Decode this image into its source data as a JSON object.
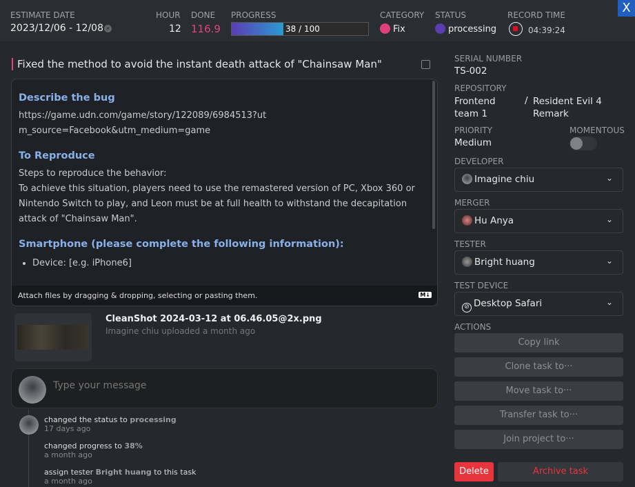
{
  "header": {
    "estimate_date_label": "ESTIMATE DATE",
    "estimate_date": "2023/12/06 - 12/08",
    "hour_label": "HOUR",
    "hour": "12",
    "done_label": "DONE",
    "done": "116.9",
    "progress_label": "PROGRESS",
    "progress_text": "38 / 100",
    "progress_value": 38,
    "category_label": "CATEGORY",
    "category": "Fix",
    "category_color": "#e0407a",
    "status_label": "STATUS",
    "status": "processing",
    "status_color": "#5a3db0",
    "record_label": "RECORD TIME",
    "record_time": "04:39:24",
    "close": "X"
  },
  "task": {
    "title": "Fixed the method to avoid the instant death attack of \"Chainsaw Man\""
  },
  "editor": {
    "h1": "Describe the bug",
    "link": "https://game.udn.com/game/story/122089/6984513?utm_source=Facebook&utm_medium=game",
    "h2": "To Reproduce",
    "p1": "Steps to reproduce the behavior:",
    "p2": "To achieve this situation, players need to use the remastered version of PC, Xbox 360 or Nintendo Switch to play, and Leon must be at full health to withstand the decapitation attack of \"Chainsaw Man\".",
    "h3": "Smartphone (please complete the following information):",
    "li1": "Device: [e.g. iPhone6]",
    "footer": "Attach files by dragging & dropping, selecting or pasting them.",
    "md_badge": "M↓"
  },
  "attachment": {
    "name": "CleanShot 2024-03-12 at 06.46.05@2x.png",
    "meta": "Imagine chiu uploaded a month ago"
  },
  "comment": {
    "placeholder": "Type your message"
  },
  "activity": [
    {
      "text": "changed the status to ",
      "highlight": "processing",
      "after": "",
      "time": "17 days ago"
    },
    {
      "text": "changed progress to ",
      "highlight": "38%",
      "after": "",
      "time": "a month ago"
    },
    {
      "text": "assign tester ",
      "highlight": "Bright huang",
      "after": " to this task",
      "time": "a month ago"
    }
  ],
  "side": {
    "serial_label": "SERIAL NUMBER",
    "serial": "TS-002",
    "repo_label": "REPOSITORY",
    "repo_team": "Frontend team 1",
    "repo_sep": "/",
    "repo_project": "Resident Evil 4 Remark",
    "priority_label": "PRIORITY",
    "priority": "Medium",
    "momentous_label": "MOMENTOUS",
    "momentous_on": false,
    "developer_label": "DEVELOPER",
    "developer": "Imagine chiu",
    "merger_label": "MERGER",
    "merger": "Hu Anya",
    "tester_label": "TESTER",
    "tester": "Bright huang",
    "device_label": "TEST DEVICE",
    "device": "Desktop Safari",
    "actions_label": "ACTIONS",
    "actions": [
      "Copy link",
      "Clone task to···",
      "Move task to···",
      "Transfer task to···",
      "Join project to···"
    ],
    "delete": "Delete",
    "archive": "Archive task"
  }
}
